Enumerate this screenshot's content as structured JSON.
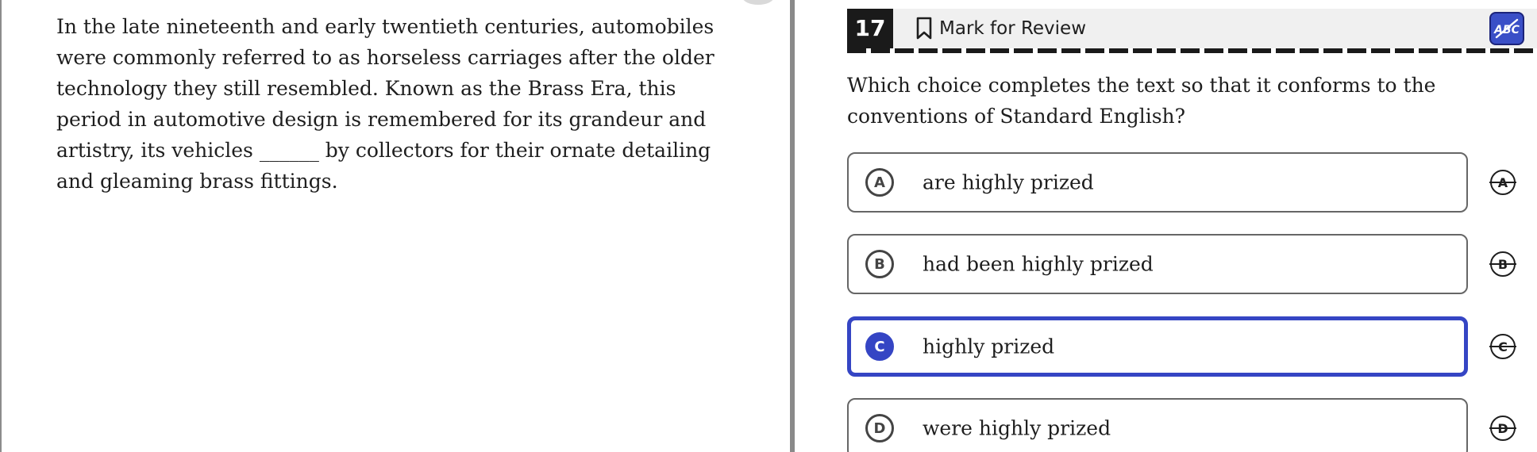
{
  "passage": {
    "text": "In the late nineteenth and early twentieth centuries, automobiles were commonly referred to as horseless carriages after the older technology they still resembled. Known as the Brass Era, this period in automotive design is remembered for its grandeur and artistry, its vehicles ______ by collectors for their ornate detailing and gleaming brass fittings."
  },
  "header": {
    "question_number": "17",
    "mark_for_review_label": "Mark for Review",
    "bookmark_icon": "bookmark-outline-icon",
    "eliminator_toggle_icon": "abc-strikethrough-icon",
    "eliminator_toggle_active": true
  },
  "question": {
    "text": "Which choice completes the text so that it conforms to the conventions of Standard English?"
  },
  "options": [
    {
      "letter": "A",
      "text": "are highly prized",
      "selected": false
    },
    {
      "letter": "B",
      "text": "had been highly prized",
      "selected": false
    },
    {
      "letter": "C",
      "text": "highly prized",
      "selected": true
    },
    {
      "letter": "D",
      "text": "were highly prized",
      "selected": false
    }
  ],
  "colors": {
    "accent": "#3545c4",
    "header_bg": "#f0f0f0",
    "question_number_bg": "#1a1a1a"
  }
}
